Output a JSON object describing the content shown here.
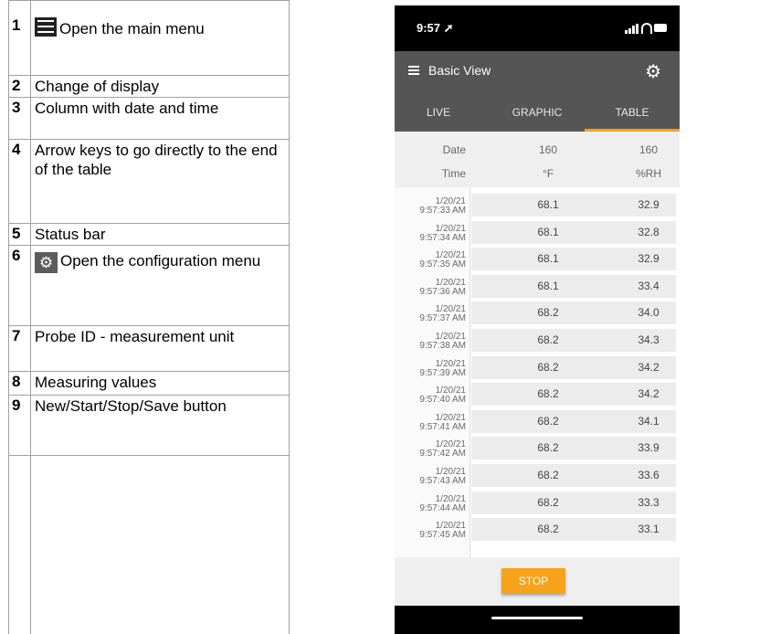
{
  "legend": [
    {
      "num": "1",
      "icon": "menu-icon",
      "text": "Open the main menu"
    },
    {
      "num": "2",
      "text": "Change of display"
    },
    {
      "num": "3",
      "text": "Column with date and time"
    },
    {
      "num": "4",
      "text": "Arrow keys to go directly to the end of the table"
    },
    {
      "num": "5",
      "text": "Status bar"
    },
    {
      "num": "6",
      "icon": "gear-icon",
      "text": "Open the configuration menu"
    },
    {
      "num": "7",
      "text": "Probe ID - measurement unit"
    },
    {
      "num": "8",
      "text": "Measuring values"
    },
    {
      "num": "9",
      "text": "New/Start/Stop/Save button"
    }
  ],
  "phone": {
    "status_time": "9:57",
    "app_title": "Basic View",
    "tabs": [
      "LIVE",
      "GRAPHIC",
      "TABLE"
    ],
    "active_tab": "TABLE",
    "accent_color": "#f7a21b",
    "header": {
      "probe_label": "Date",
      "unit_label": "Time",
      "col1_probe": "160",
      "col1_unit": "°F",
      "col2_probe": "160",
      "col2_unit": "%RH"
    },
    "rows": [
      {
        "date": "1/20/21",
        "time": "9:57:33 AM",
        "f": "68.1",
        "rh": "32.9"
      },
      {
        "date": "1/20/21",
        "time": "9:57:34 AM",
        "f": "68.1",
        "rh": "32.8"
      },
      {
        "date": "1/20/21",
        "time": "9:57:35 AM",
        "f": "68.1",
        "rh": "32.9"
      },
      {
        "date": "1/20/21",
        "time": "9:57:36 AM",
        "f": "68.1",
        "rh": "33.4"
      },
      {
        "date": "1/20/21",
        "time": "9:57:37 AM",
        "f": "68.2",
        "rh": "34.0"
      },
      {
        "date": "1/20/21",
        "time": "9:57:38 AM",
        "f": "68.2",
        "rh": "34.3"
      },
      {
        "date": "1/20/21",
        "time": "9:57:39 AM",
        "f": "68.2",
        "rh": "34.2"
      },
      {
        "date": "1/20/21",
        "time": "9:57:40 AM",
        "f": "68.2",
        "rh": "34.2"
      },
      {
        "date": "1/20/21",
        "time": "9:57:41 AM",
        "f": "68.2",
        "rh": "34.1"
      },
      {
        "date": "1/20/21",
        "time": "9:57:42 AM",
        "f": "68.2",
        "rh": "33.9"
      },
      {
        "date": "1/20/21",
        "time": "9:57:43 AM",
        "f": "68.2",
        "rh": "33.6"
      },
      {
        "date": "1/20/21",
        "time": "9:57:44 AM",
        "f": "68.2",
        "rh": "33.3"
      },
      {
        "date": "1/20/21",
        "time": "9:57:45 AM",
        "f": "68.2",
        "rh": "33.1"
      }
    ],
    "stop_label": "STOP"
  }
}
